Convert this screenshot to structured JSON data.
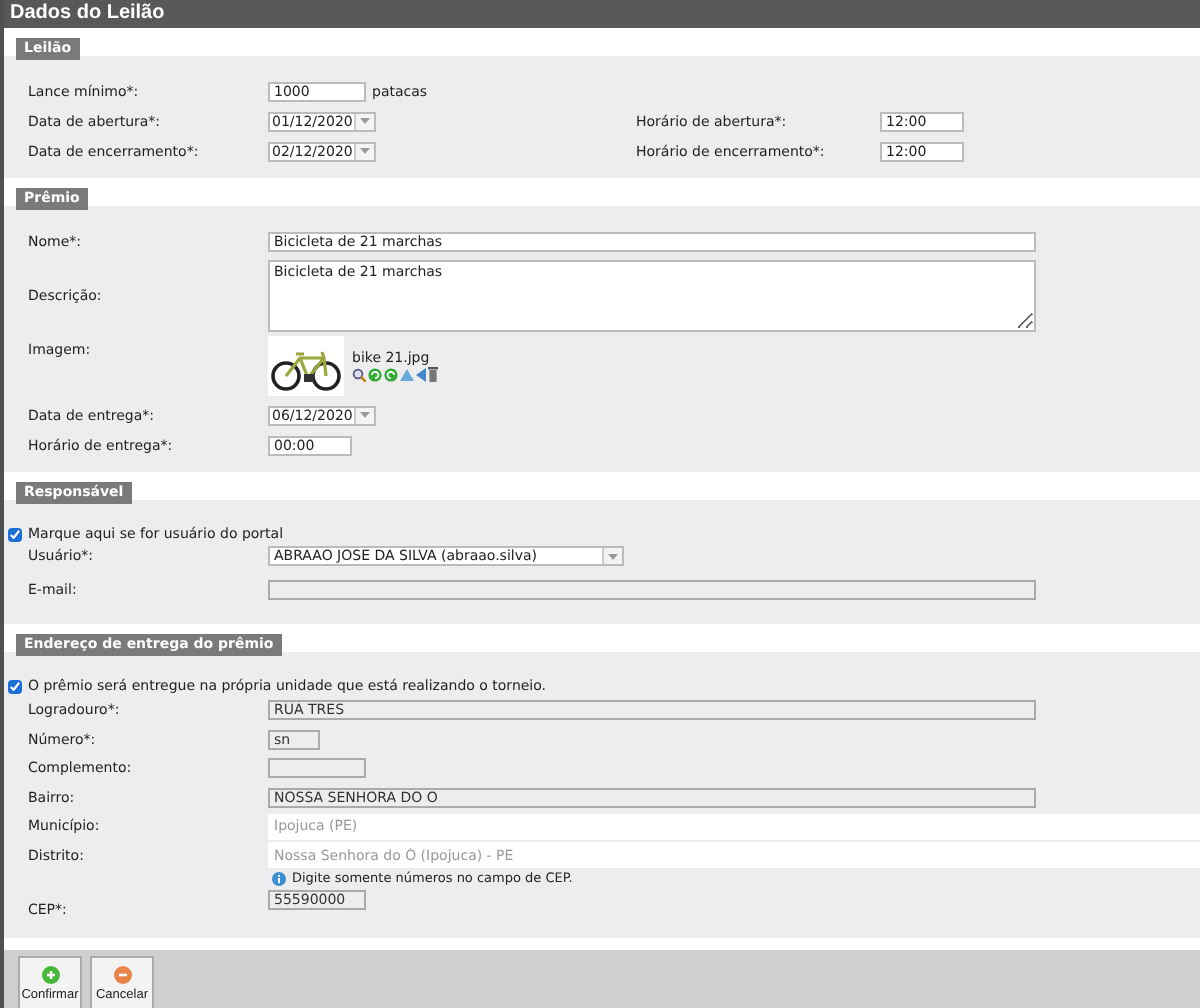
{
  "title": "Dados do Leilão",
  "leilao": {
    "title": "Leilão",
    "lance": {
      "label": "Lance mínimo*:",
      "value": "1000",
      "unit": "patacas"
    },
    "abertura": {
      "date_label": "Data de abertura*:",
      "date": "01/12/2020",
      "time_label": "Horário de abertura*:",
      "time": "12:00"
    },
    "encerramento": {
      "date_label": "Data de encerramento*:",
      "date": "02/12/2020",
      "time_label": "Horário de encerramento*:",
      "time": "12:00"
    }
  },
  "premio": {
    "title": "Prêmio",
    "nome": {
      "label": "Nome*:",
      "value": "Bicicleta de 21 marchas"
    },
    "descricao": {
      "label": "Descrição:",
      "value": "Bicicleta de 21 marchas"
    },
    "imagem": {
      "label": "Imagem:",
      "filename": "bike 21.jpg"
    },
    "data_entrega": {
      "label": "Data de entrega*:",
      "value": "06/12/2020"
    },
    "horario_entrega": {
      "label": "Horário de entrega*:",
      "value": "00:00"
    }
  },
  "responsavel": {
    "title": "Responsável",
    "portal": {
      "label": "Marque aqui se for usuário do portal",
      "checked": true
    },
    "usuario": {
      "label": "Usuário*:",
      "value": "ABRAAO JOSE DA SILVA (abraao.silva)"
    },
    "email": {
      "label": "E-mail:"
    }
  },
  "endereco": {
    "title": "Endereço de entrega do prêmio",
    "mesma_unidade": {
      "label": "O prêmio será entregue na própria unidade que está realizando o torneio.",
      "checked": true
    },
    "fields": [
      {
        "label": "Logradouro*:",
        "value": "RUA TRES",
        "kind": "locked"
      },
      {
        "label": "Número*:",
        "value": "sn",
        "kind": "locked"
      },
      {
        "label": "Complemento:",
        "kind": "locked"
      },
      {
        "label": "Bairro:",
        "value": "NOSSA SENHORA DO O",
        "kind": "locked"
      },
      {
        "label": "Município:",
        "value": "Ipojuca (PE)",
        "kind": "lookup"
      },
      {
        "label": "Distrito:",
        "value": "Nossa Senhora do Ó (Ipojuca) - PE",
        "kind": "lookup"
      }
    ],
    "hint": "Digite somente números no campo de CEP.",
    "cep": {
      "label": "CEP*:",
      "value": "55590000"
    }
  },
  "buttons": [
    {
      "label": "Confirmar",
      "kind": "confirm"
    },
    {
      "label": "Cancelar",
      "kind": "cancel"
    }
  ]
}
